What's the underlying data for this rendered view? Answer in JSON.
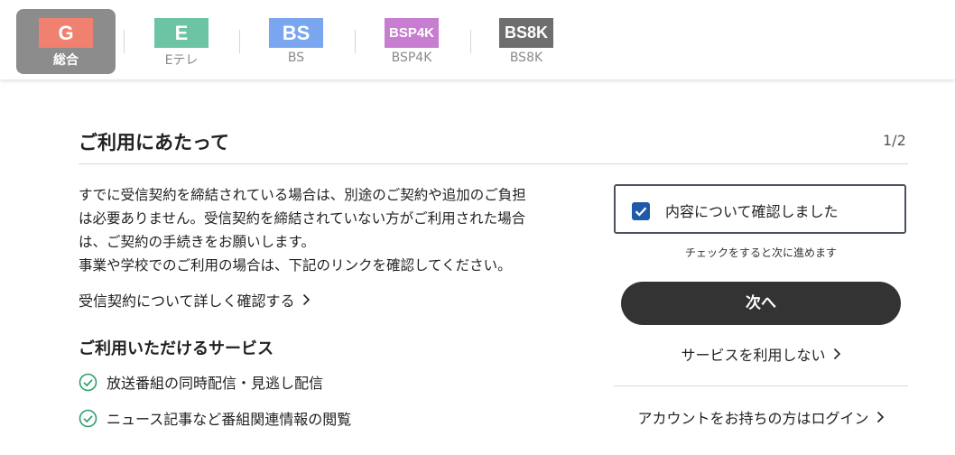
{
  "channels": [
    {
      "badge": "G",
      "label": "総合",
      "color": "#f08070",
      "active": true
    },
    {
      "badge": "E",
      "label": "Eテレ",
      "color": "#6cc4a4",
      "active": false
    },
    {
      "badge": "BS",
      "label": "BS",
      "color": "#7aa6ef",
      "active": false
    },
    {
      "badge": "BSP4K",
      "label": "BSP4K",
      "color": "#c87ed0",
      "active": false
    },
    {
      "badge": "BS8K",
      "label": "BS8K",
      "color": "#6e6e6e",
      "active": false
    }
  ],
  "main": {
    "title": "ご利用にあたって",
    "page_indicator": "1/2",
    "description": [
      "すでに受信契約を締結されている場合は、別途のご契約や追加のご負担",
      "は必要ありません。受信契約を締結されていない方がご利用された場合",
      "は、ご契約の手続きをお願いします。",
      "事業や学校でのご利用の場合は、下記のリンクを確認してください。"
    ],
    "contract_link": "受信契約について詳しく確認する",
    "services_heading": "ご利用いただけるサービス",
    "services": [
      "放送番組の同時配信・見逃し配信",
      "ニュース記事など番組関連情報の閲覧"
    ]
  },
  "confirm": {
    "checkbox_label": "内容について確認しました",
    "checked": true,
    "hint": "チェックをすると次に進めます",
    "next_button": "次へ",
    "decline_link": "サービスを利用しない",
    "login_link": "アカウントをお持ちの方はログイン"
  },
  "icons": {
    "checkmark": "check-icon",
    "chevron": "chevron-right-icon",
    "service_check": "circle-check-icon"
  },
  "colors": {
    "accent": "#1f5aa8",
    "button_bg": "#333333",
    "service_icon": "#2f9e6e"
  }
}
